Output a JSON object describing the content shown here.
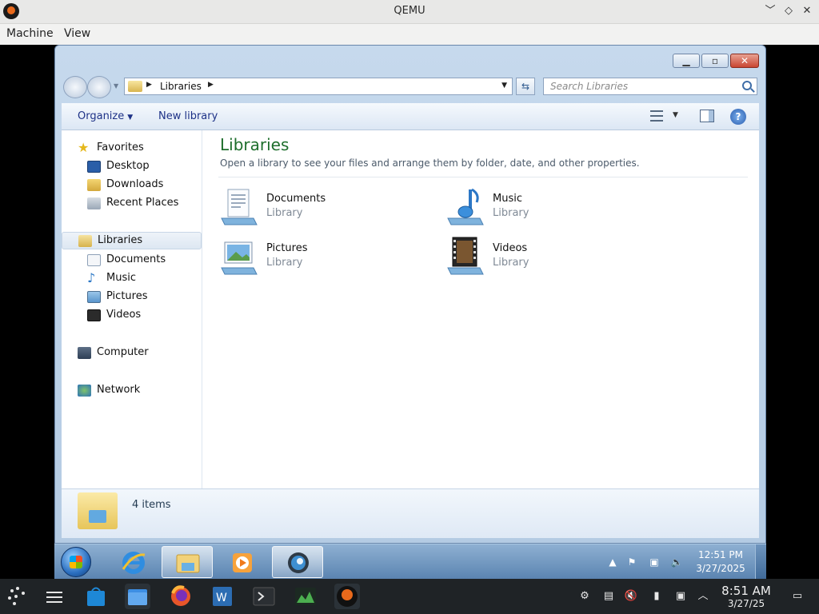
{
  "host": {
    "title": "QEMU",
    "controls": [
      "﹀",
      "◇",
      "✕"
    ],
    "menu": [
      "Machine",
      "View"
    ],
    "taskbar": {
      "time": "8:51 AM",
      "date": "3/27/25"
    }
  },
  "explorer": {
    "address": {
      "crumb": "Libraries"
    },
    "search_placeholder": "Search Libraries",
    "toolbar": {
      "organize": "Organize",
      "new_library": "New library"
    },
    "nav": {
      "favorites": "Favorites",
      "desktop": "Desktop",
      "downloads": "Downloads",
      "recent_places": "Recent Places",
      "libraries": "Libraries",
      "documents": "Documents",
      "music": "Music",
      "pictures": "Pictures",
      "videos": "Videos",
      "computer": "Computer",
      "network": "Network"
    },
    "content": {
      "title": "Libraries",
      "description": "Open a library to see your files and arrange them by folder, date, and other properties.",
      "libraries": [
        {
          "name": "Documents",
          "type": "Library"
        },
        {
          "name": "Music",
          "type": "Library"
        },
        {
          "name": "Pictures",
          "type": "Library"
        },
        {
          "name": "Videos",
          "type": "Library"
        }
      ]
    },
    "details": {
      "count": "4 items"
    }
  },
  "guest_taskbar": {
    "time": "12:51 PM",
    "date": "3/27/2025"
  },
  "colors": {
    "library_title": "#1e6e2c",
    "link_blue": "#1e3287",
    "host_taskbar": "#1f2326"
  }
}
